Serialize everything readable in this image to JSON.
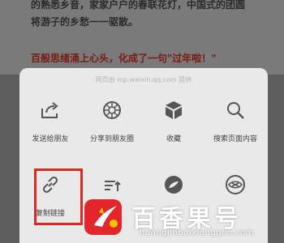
{
  "article": {
    "line1": "的熟悉乡音，家家户户的春联花灯，中国式的团圆",
    "line2": "将游子的乡愁一一驱散。",
    "line3": "百般思绪涌上心头，化成了一句\"过年啦！\""
  },
  "sheet": {
    "source": "网页由 mp.weixin.qq.com 提供",
    "row1": [
      {
        "label": "发送给朋友",
        "icon": "share-arrow-icon"
      },
      {
        "label": "分享到朋友圈",
        "icon": "moments-icon"
      },
      {
        "label": "收藏",
        "icon": "favorite-cube-icon"
      },
      {
        "label": "搜索页面内容",
        "icon": "search-icon"
      }
    ],
    "row2": [
      {
        "label": "复制链接",
        "icon": "link-icon"
      },
      {
        "label": "",
        "icon": "adjust-font-icon"
      },
      {
        "label": "",
        "icon": "browser-icon"
      },
      {
        "label": "",
        "icon": "eye-icon"
      }
    ]
  },
  "watermark": {
    "name": "百香果号",
    "url": "huangjinbaixiangguo.com"
  },
  "colors": {
    "highlight": "#d62a22",
    "sheet_bg": "#e9e9e9"
  }
}
